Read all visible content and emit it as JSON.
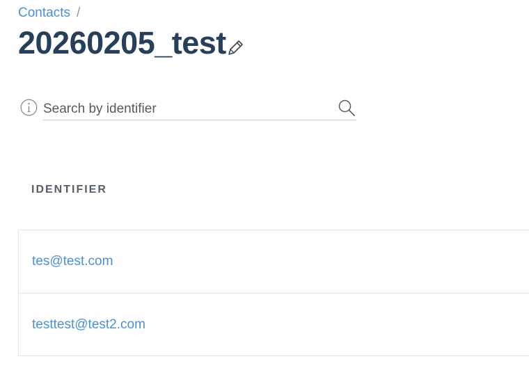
{
  "breadcrumb": {
    "parent_label": "Contacts",
    "separator": "/"
  },
  "page": {
    "title": "20260205_test",
    "edit_icon": "pencil-icon"
  },
  "search": {
    "placeholder": "Search by identifier",
    "value": "",
    "info_icon": "info-icon",
    "search_icon": "search-icon"
  },
  "table": {
    "columns": [
      "IDENTIFIER"
    ],
    "rows": [
      {
        "identifier": "tes@test.com"
      },
      {
        "identifier": "testtest@test2.com"
      }
    ]
  },
  "colors": {
    "link": "#4a90d9",
    "title": "#263f5a",
    "header": "#56606b",
    "border": "#e2e5e8"
  }
}
